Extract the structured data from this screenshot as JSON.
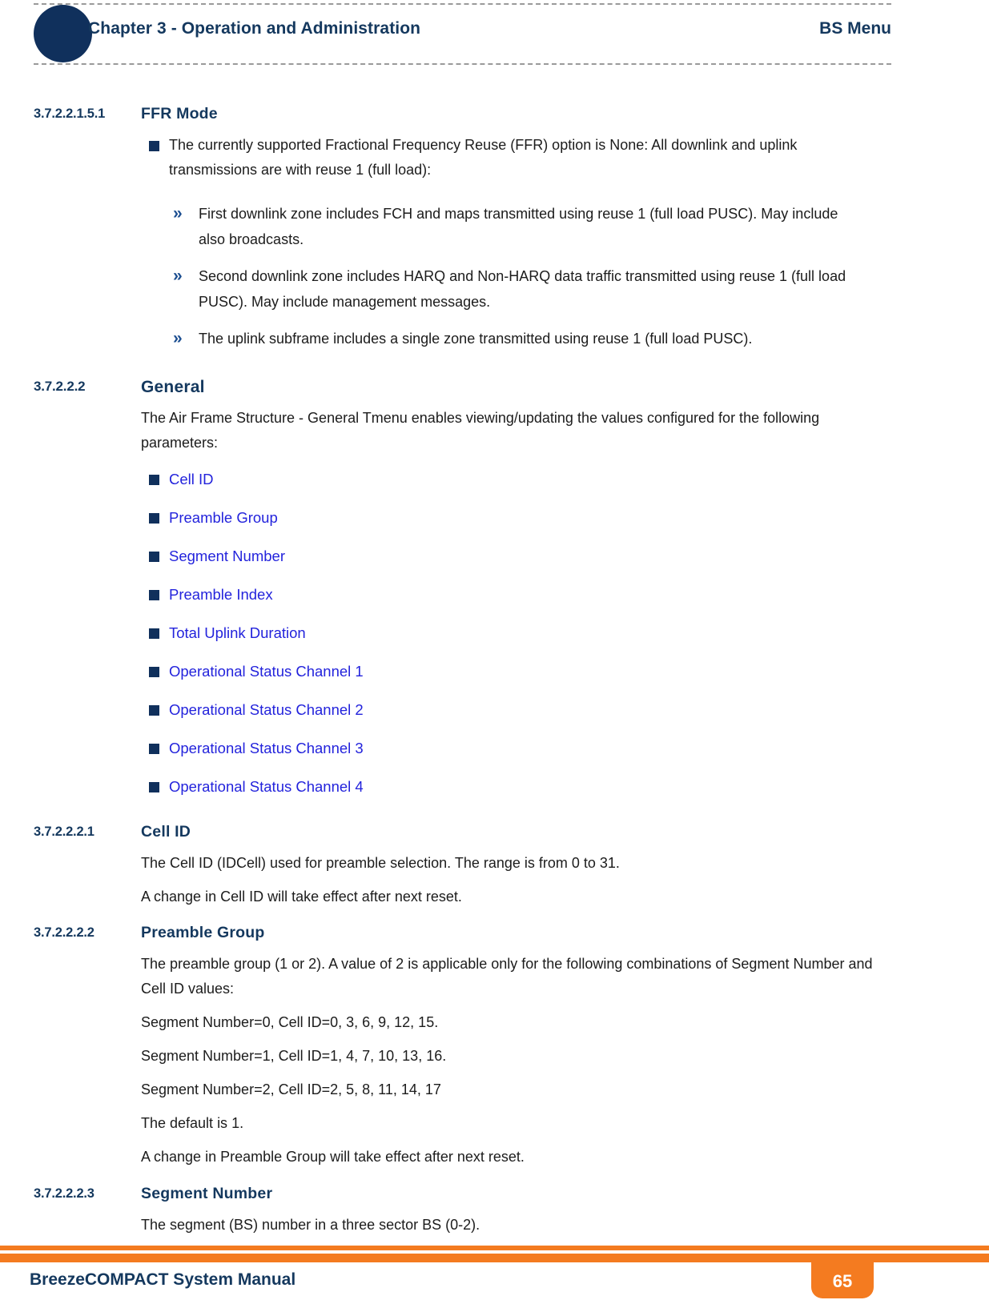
{
  "header": {
    "chapter_title": "Chapter 3 - Operation and Administration",
    "section_title": "BS Menu"
  },
  "sections": {
    "ffr_mode": {
      "number": "3.7.2.2.1.5.1",
      "title": "FFR Mode",
      "bullet": "The currently supported Fractional Frequency Reuse (FFR) option is None: All downlink and uplink transmissions are with reuse 1 (full load):",
      "sub_bullets": [
        "First downlink zone includes FCH and maps transmitted using reuse 1 (full load PUSC). May include also broadcasts.",
        "Second downlink zone includes HARQ and Non-HARQ data traffic transmitted using reuse 1 (full load PUSC). May include management messages.",
        "The uplink subframe includes a single zone transmitted using reuse 1 (full load PUSC)."
      ]
    },
    "general": {
      "number": "3.7.2.2.2",
      "title": "General",
      "intro": "The Air Frame Structure - General Tmenu enables viewing/updating the values configured for the following parameters:",
      "links": [
        "Cell ID",
        "Preamble Group",
        "Segment Number",
        "Preamble Index",
        "Total Uplink Duration",
        "Operational Status Channel 1",
        "Operational Status Channel 2",
        "Operational Status Channel 3",
        "Operational Status Channel 4"
      ]
    },
    "cell_id": {
      "number": "3.7.2.2.2.1",
      "title": "Cell ID",
      "paras": [
        "The Cell ID (IDCell) used for preamble selection. The range is from 0 to 31.",
        "A change in Cell ID will take effect after next reset."
      ]
    },
    "preamble_group": {
      "number": "3.7.2.2.2.2",
      "title": "Preamble Group",
      "paras": [
        "The preamble group (1 or 2). A value of 2 is applicable only for the following combinations of Segment Number and Cell ID values:",
        "Segment Number=0, Cell ID=0, 3, 6, 9, 12, 15.",
        "Segment Number=1, Cell ID=1, 4, 7, 10, 13, 16.",
        "Segment Number=2, Cell ID=2, 5, 8, 11, 14, 17",
        "The default is 1.",
        "A change in Preamble Group will take effect after next reset."
      ]
    },
    "segment_number": {
      "number": "3.7.2.2.2.3",
      "title": "Segment Number",
      "paras": [
        "The segment (BS) number in a three sector BS (0-2)."
      ]
    }
  },
  "footer": {
    "doc_title": "BreezeCOMPACT System Manual",
    "page_number": "65"
  },
  "colors": {
    "navy": "#14385e",
    "circle_navy": "#10305c",
    "link_blue": "#2323dc",
    "orange": "#f47b20",
    "rule_gray": "#9a9a9a"
  }
}
